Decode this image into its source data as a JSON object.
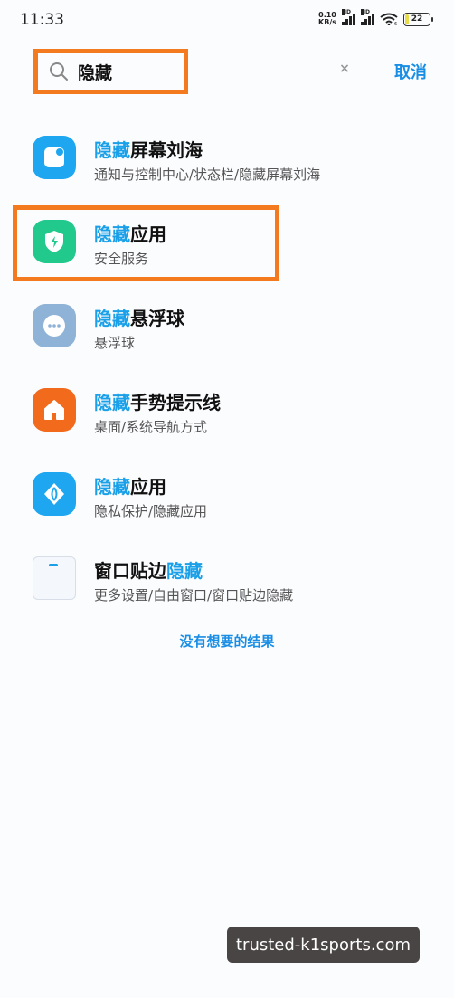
{
  "status": {
    "time": "11:33",
    "net_speed_value": "0.10",
    "net_speed_unit": "KB/s",
    "hd1": "HD",
    "hd2": "HD",
    "wifi_badge": "6",
    "battery": "22"
  },
  "search": {
    "query": "隐藏",
    "cancel_label": "取消",
    "clear_symbol": "×"
  },
  "results": [
    {
      "icon": "notch-icon",
      "icon_color": "#1ea7f0",
      "title_highlight": "隐藏",
      "title_rest": "屏幕刘海",
      "subtitle": "通知与控制中心/状态栏/隐藏屏幕刘海"
    },
    {
      "icon": "security-shield-icon",
      "icon_color": "#22c98d",
      "title_highlight": "隐藏",
      "title_rest": "应用",
      "subtitle": "安全服务"
    },
    {
      "icon": "floating-ball-icon",
      "icon_color": "#8fb3d6",
      "title_highlight": "隐藏",
      "title_rest": "悬浮球",
      "subtitle": "悬浮球"
    },
    {
      "icon": "home-gesture-icon",
      "icon_color": "#f26b1d",
      "title_highlight": "隐藏",
      "title_rest": "手势提示线",
      "subtitle": "桌面/系统导航方式"
    },
    {
      "icon": "privacy-icon",
      "icon_color": "#1ea7f0",
      "title_highlight": "隐藏",
      "title_rest": "应用",
      "subtitle": "隐私保护/隐藏应用"
    },
    {
      "icon": "window-edge-icon",
      "icon_color": "#f4f7fb",
      "title_prefix": "窗口贴边",
      "title_highlight": "隐藏",
      "subtitle": "更多设置/自由窗口/窗口贴边隐藏"
    }
  ],
  "no_result_text": "没有想要的结果",
  "watermark": "trusted-k1sports.com",
  "colors": {
    "accent": "#1a8ee5",
    "highlight": "#1aa0e8",
    "annotation": "#f47a20"
  }
}
